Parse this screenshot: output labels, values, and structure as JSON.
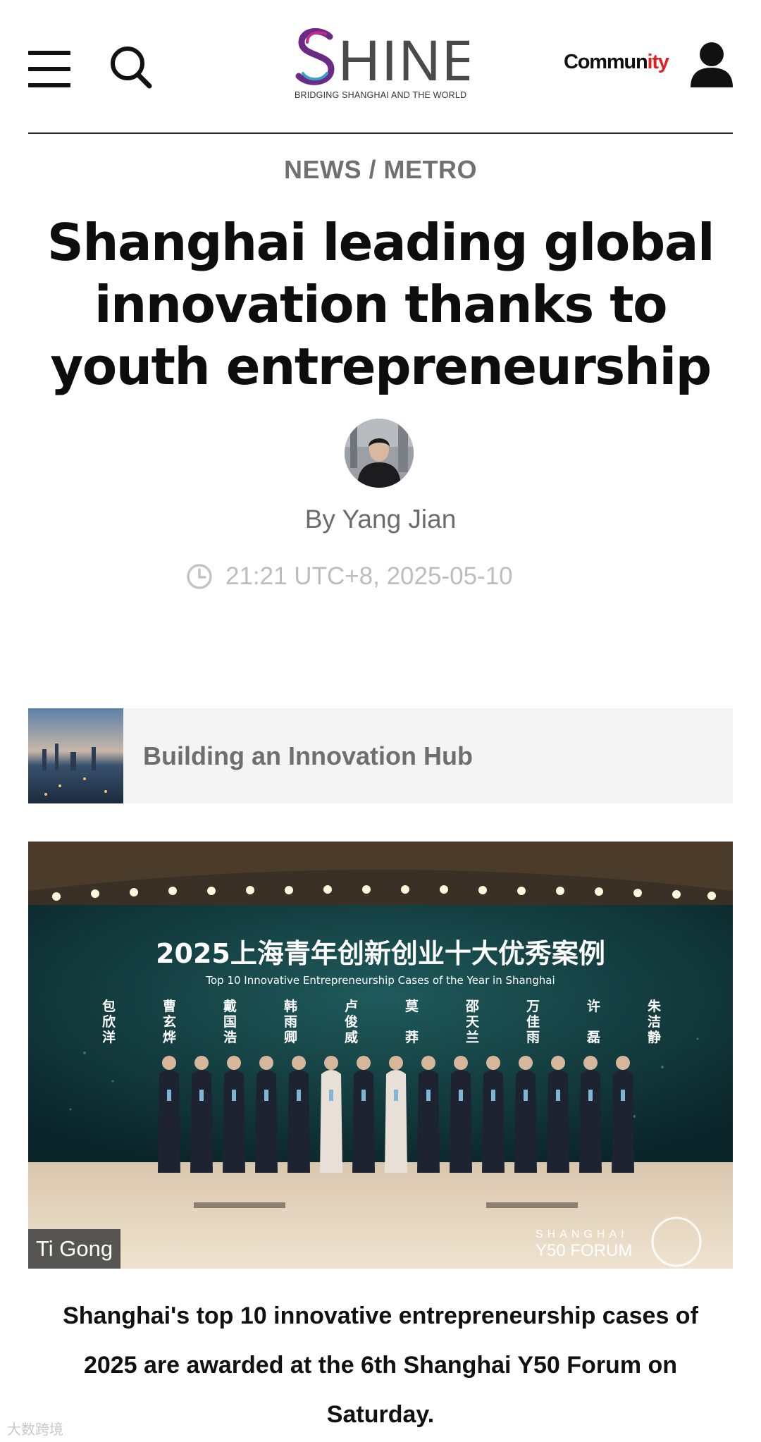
{
  "header": {
    "logo_text": "SHINE",
    "logo_tagline": "BRIDGING SHANGHAI AND THE WORLD",
    "community_label_main": "Commun",
    "community_label_accent": "ity",
    "accent_color": "#e02020",
    "brand_color": "#6b2a86"
  },
  "breadcrumb": {
    "section": "NEWS",
    "separator": " / ",
    "subsection": "METRO"
  },
  "article": {
    "title": "Shanghai leading global innovation thanks to youth entrepreneurship",
    "author": "By Yang Jian",
    "datetime": "21:21 UTC+8, 2025-05-10",
    "related_title": "Building an Innovation Hub",
    "photo_credit": "Ti Gong",
    "caption": "Shanghai's top 10 innovative entrepreneurship cases of 2025 are awarded at the 6th Shanghai Y50 Forum on Saturday."
  },
  "photo_content": {
    "screen_title": "2025上海青年创新创业十大优秀案例",
    "screen_subtitle": "Top 10 Innovative Entrepreneurship Cases of the Year in Shanghai",
    "names": [
      "包欣洋",
      "曹玄烨",
      "戴国浩",
      "韩雨卿",
      "卢俊威",
      "莫 莽",
      "邵天兰",
      "万佳雨",
      "许 磊",
      "朱洁静"
    ],
    "forum_badge_top": "SHANGHAI",
    "forum_badge_bottom": "Y50 FORUM"
  },
  "icons": {
    "menu": "hamburger-icon",
    "search": "search-icon",
    "user": "user-icon",
    "clock": "clock-icon"
  },
  "watermark": "大数跨境"
}
